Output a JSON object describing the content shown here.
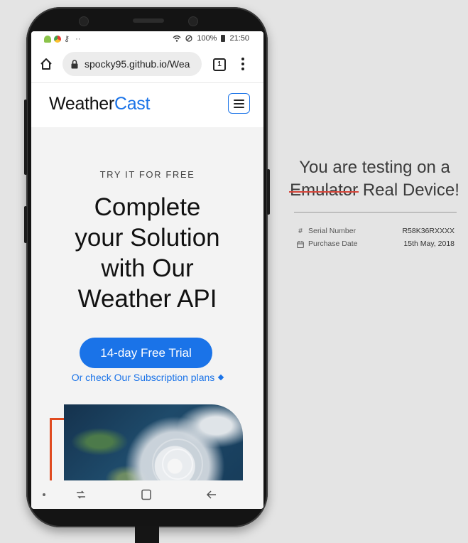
{
  "status_bar": {
    "time": "21:50",
    "battery": "100%",
    "dots": "··"
  },
  "browser": {
    "url": "spocky95.github.io/Wea",
    "tab_count": "1"
  },
  "site": {
    "logo_part1": "Weather",
    "logo_part2": "Cast",
    "eyebrow": "TRY IT FOR FREE",
    "headline_lines": [
      "Complete",
      "your Solution",
      "with Our",
      "Weather API"
    ],
    "cta_label": "14-day Free Trial",
    "plans_link": "Or check Our Subscription plans"
  },
  "panel": {
    "title_line1": "You are testing on a",
    "struck_word": "Emulator",
    "title_line2_rest": "Real Device!",
    "serial_label": "Serial Number",
    "serial_value": "R58K36RXXXX",
    "purchase_label": "Purchase Date",
    "purchase_value": "15th May, 2018"
  },
  "colors": {
    "brand_blue": "#1a73e8",
    "accent_orange": "#e04a1f",
    "strike_red": "#d6453a"
  },
  "icons": [
    "android-icon",
    "chrome-icon",
    "key-icon",
    "wifi-icon",
    "no-disturb-icon",
    "battery-icon",
    "home-icon",
    "lock-icon",
    "tabs-icon",
    "overflow-menu-icon",
    "hamburger-icon",
    "recent-apps-icon",
    "nav-home-icon",
    "back-icon",
    "hash-icon",
    "calendar-icon"
  ]
}
